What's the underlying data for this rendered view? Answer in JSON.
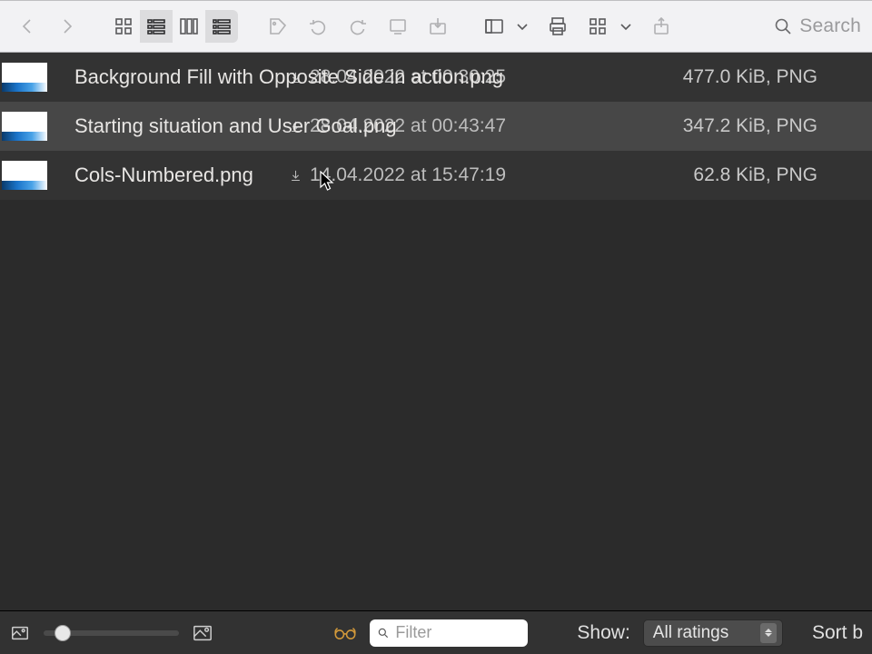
{
  "toolbar": {
    "search_placeholder": "Search"
  },
  "files": [
    {
      "name": "Background Fill with Opposite Side in action.png",
      "date": "28.04.2022 at 00:30:25",
      "size": "477.0 KiB",
      "type": "PNG"
    },
    {
      "name": "Starting situation and User Goal.png",
      "date": "28.04.2022 at 00:43:47",
      "size": "347.2 KiB",
      "type": "PNG"
    },
    {
      "name": "Cols-Numbered.png",
      "date": "14.04.2022 at 15:47:19",
      "size": "62.8 KiB",
      "type": "PNG"
    }
  ],
  "bottombar": {
    "filter_placeholder": "Filter",
    "show_label": "Show:",
    "ratings_value": "All ratings",
    "sort_label": "Sort b"
  }
}
